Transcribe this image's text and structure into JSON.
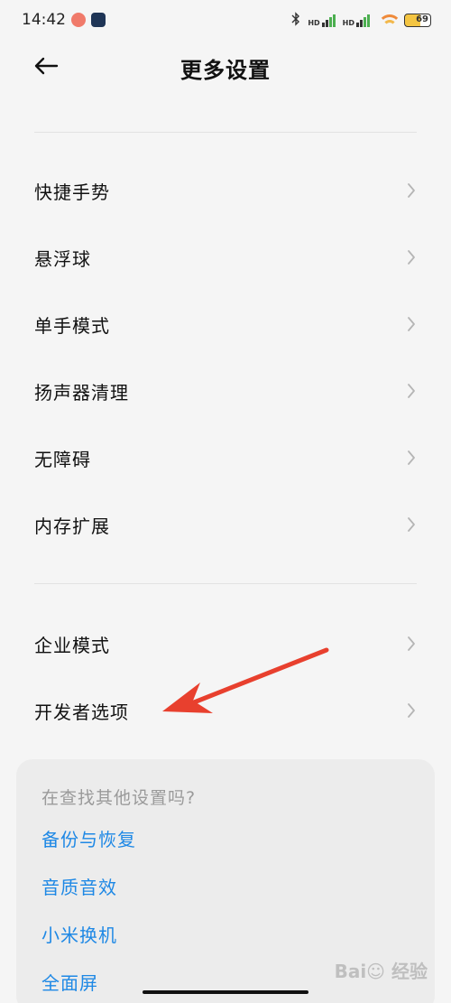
{
  "status_bar": {
    "time": "14:42",
    "battery": "69"
  },
  "header": {
    "title": "更多设置"
  },
  "list_group_1": [
    {
      "label": "快捷手势"
    },
    {
      "label": "悬浮球"
    },
    {
      "label": "单手模式"
    },
    {
      "label": "扬声器清理"
    },
    {
      "label": "无障碍"
    },
    {
      "label": "内存扩展"
    }
  ],
  "list_group_2": [
    {
      "label": "企业模式"
    },
    {
      "label": "开发者选项"
    }
  ],
  "suggestions": {
    "title": "在查找其他设置吗?",
    "links": [
      "备份与恢复",
      "音质音效",
      "小米换机",
      "全面屏"
    ]
  },
  "colors": {
    "link": "#1e88e5",
    "annotation_arrow": "#e8402e"
  }
}
